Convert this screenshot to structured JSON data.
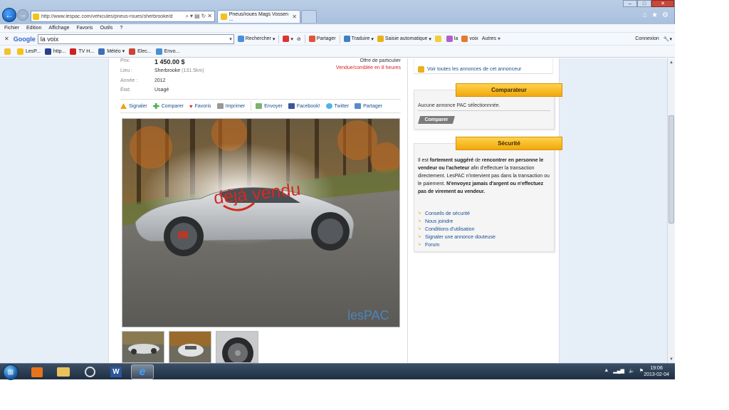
{
  "browser": {
    "url": "http://www.lespac.com/vehicules/pneus-roues/sherbrooke/d",
    "tab_title": "Pneus/roues Mags Vossen ...",
    "menu": [
      "Fichier",
      "Edition",
      "Affichage",
      "Favoris",
      "Outils",
      "?"
    ],
    "toolbar": {
      "google_label": "Google",
      "search_value": "la voix",
      "rechercher": "Rechercher",
      "partager": "Partager",
      "traduire": "Traduire",
      "saisie": "Saisie automatique",
      "la": "la",
      "voix": "voix",
      "autres": "Autres",
      "connexion": "Connexion"
    },
    "favorites": [
      "LesP...",
      "http...",
      "TV H...",
      "Météo",
      "Elec...",
      "Envo..."
    ]
  },
  "listing": {
    "price_label": "Prix:",
    "price": "1 450.00 $",
    "location_label": "Lieu :",
    "location": "Sherbrooke",
    "distance": "(131.5km)",
    "year_label": "Année :",
    "year": "2012",
    "state_label": "État:",
    "state": "Usagé",
    "seller_type": "Offre de particulier",
    "sold_status": "Vendue/comblée en 8 heures",
    "photo_overlay": "déjà vendu",
    "watermark": "lesPAC"
  },
  "actions": {
    "signaler": "Signaler",
    "comparer": "Comparer",
    "favoris": "Favoris",
    "imprimer": "Imprimer",
    "envoyer": "Envoyer",
    "facebook": "Facebook!",
    "twitter": "Twitter",
    "partager": "Partager"
  },
  "sidebar": {
    "view_all": "Voir toutes les annonces de cet annonceur",
    "comparateur": {
      "title": "Comparateur",
      "message": "Aucune annonce PAC sélectionnnée.",
      "button": "Comparer"
    },
    "securite": {
      "title": "Sécurité",
      "text_1": "Il est ",
      "text_2": "fortement suggéré",
      "text_3": " de ",
      "text_4": "rencontrer en personne le vendeur ou l'acheteur",
      "text_5": " afin d'effectuer la transaction directement. LesPAC n'intervient pas dans la transaction ou le paiement. ",
      "text_6": "N'envoyez jamais d'argent ou n'effectuez pas de virement au vendeur.",
      "links": [
        "Conseils de sécurité",
        "Nous joindre",
        "Conditions d'utilisation",
        "Signaler une annonce douteuse",
        "Forum"
      ]
    }
  },
  "taskbar": {
    "time": "19:06",
    "date": "2013-02-04"
  },
  "colors": {
    "accent_link": "#1a4f91",
    "sold_red": "#dd2222",
    "tab_yellow": "#f1a80c"
  }
}
